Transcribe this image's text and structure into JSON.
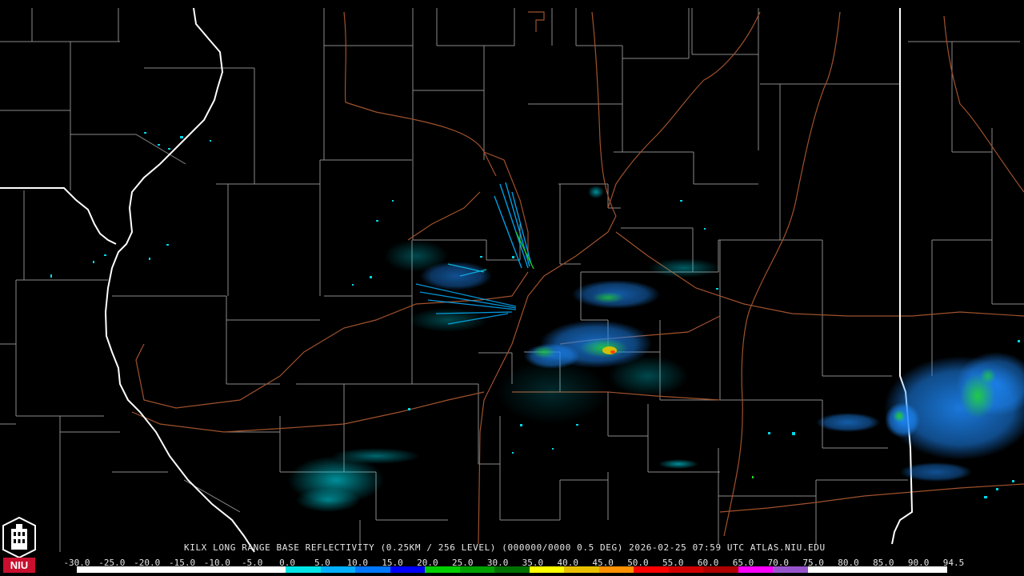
{
  "caption": "KILX LONG RANGE BASE REFLECTIVITY (0.25KM / 256 LEVEL) (000000/0000 0.5 DEG) 2026-02-25 07:59 UTC  ATLAS.NIU.EDU",
  "logo": {
    "text": "NIU",
    "icon": "niu-tower-logo-icon",
    "color": "#c8102e"
  },
  "scale": {
    "labels": [
      "-30.0",
      "-25.0",
      "-20.0",
      "-15.0",
      "-10.0",
      "-5.0",
      "0.0",
      "5.0",
      "10.0",
      "15.0",
      "20.0",
      "25.0",
      "30.0",
      "35.0",
      "40.0",
      "45.0",
      "50.0",
      "55.0",
      "60.0",
      "65.0",
      "70.0",
      "75.0",
      "80.0",
      "85.0",
      "90.0",
      "94.5"
    ],
    "colors": [
      "#ffffff",
      "#ffffff",
      "#ffffff",
      "#ffffff",
      "#ffffff",
      "#ffffff",
      "#00e5e5",
      "#00b0ff",
      "#0077ff",
      "#0000ff",
      "#00d000",
      "#00a000",
      "#007000",
      "#ffff00",
      "#e8c000",
      "#ff9000",
      "#ff0000",
      "#d00000",
      "#b00000",
      "#ff00ff",
      "#9955cc",
      "#ffffff",
      "#ffffff",
      "#ffffff",
      "#ffffff"
    ]
  },
  "colors": {
    "background": "#000000",
    "county_border": "#8a8a8a",
    "state_border": "#ffffff",
    "highway": "#a0522d"
  }
}
